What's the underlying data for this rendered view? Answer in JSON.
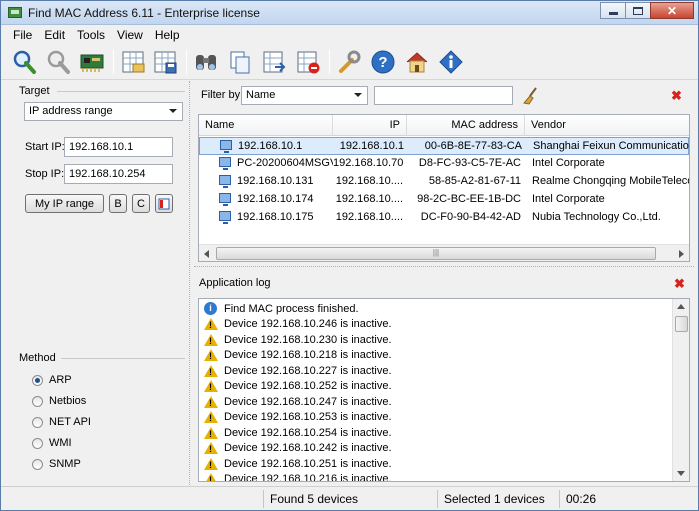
{
  "window": {
    "title": "Find MAC Address 6.11 - Enterprise license"
  },
  "menu": [
    "File",
    "Edit",
    "Tools",
    "View",
    "Help"
  ],
  "toolbar": {
    "icons": [
      "scan-icon",
      "stop-icon",
      "network-card-icon",
      "open-folder-icon",
      "save-icon",
      "find-icon",
      "copy-icon",
      "export-icon",
      "delete-icon",
      "options-icon",
      "help-icon",
      "home-icon",
      "about-icon"
    ]
  },
  "target": {
    "label": "Target",
    "mode": "IP address range",
    "start_label": "Start IP:",
    "start_value": "192.168.10.1",
    "stop_label": "Stop IP:",
    "stop_value": "192.168.10.254",
    "my_ip_button": "My IP range",
    "b_button": "B",
    "c_button": "C"
  },
  "method": {
    "label": "Method",
    "options": [
      "ARP",
      "Netbios",
      "NET API",
      "WMI",
      "SNMP"
    ],
    "selected": "ARP"
  },
  "filter": {
    "label": "Filter by",
    "field": "Name",
    "value": ""
  },
  "results": {
    "columns": [
      "Name",
      "IP",
      "MAC address",
      "Vendor"
    ],
    "rows": [
      {
        "name": "192.168.10.1",
        "ip": "192.168.10.1",
        "mac": "00-6B-8E-77-83-CA",
        "vendor": "Shanghai Feixun Communication Co...."
      },
      {
        "name": "PC-20200604MSGV",
        "ip": "192.168.10.70",
        "mac": "D8-FC-93-C5-7E-AC",
        "vendor": "Intel Corporate"
      },
      {
        "name": "192.168.10.131",
        "ip": "192.168.10....",
        "mac": "58-85-A2-81-67-11",
        "vendor": "Realme Chongqing MobileTelecomm..."
      },
      {
        "name": "192.168.10.174",
        "ip": "192.168.10....",
        "mac": "98-2C-BC-EE-1B-DC",
        "vendor": "Intel Corporate"
      },
      {
        "name": "192.168.10.175",
        "ip": "192.168.10....",
        "mac": "DC-F0-90-B4-42-AD",
        "vendor": "Nubia Technology Co.,Ltd."
      }
    ],
    "selected_index": 0
  },
  "log": {
    "label": "Application log",
    "entries": [
      {
        "type": "info",
        "text": "Find MAC process finished."
      },
      {
        "type": "warn",
        "text": "Device 192.168.10.246 is inactive."
      },
      {
        "type": "warn",
        "text": "Device 192.168.10.230 is inactive."
      },
      {
        "type": "warn",
        "text": "Device 192.168.10.218 is inactive."
      },
      {
        "type": "warn",
        "text": "Device 192.168.10.227 is inactive."
      },
      {
        "type": "warn",
        "text": "Device 192.168.10.252 is inactive."
      },
      {
        "type": "warn",
        "text": "Device 192.168.10.247 is inactive."
      },
      {
        "type": "warn",
        "text": "Device 192.168.10.253 is inactive."
      },
      {
        "type": "warn",
        "text": "Device 192.168.10.254 is inactive."
      },
      {
        "type": "warn",
        "text": "Device 192.168.10.242 is inactive."
      },
      {
        "type": "warn",
        "text": "Device 192.168.10.251 is inactive."
      },
      {
        "type": "warn",
        "text": "Device 192.168.10.216 is inactive."
      }
    ]
  },
  "status": {
    "found": "Found 5 devices",
    "selected": "Selected 1 devices",
    "time": "00:26"
  },
  "colors": {
    "accent": "#2b5fa8",
    "close_x": "#d6241d",
    "selection": "#dcecfc",
    "warning": "#e8b000"
  }
}
